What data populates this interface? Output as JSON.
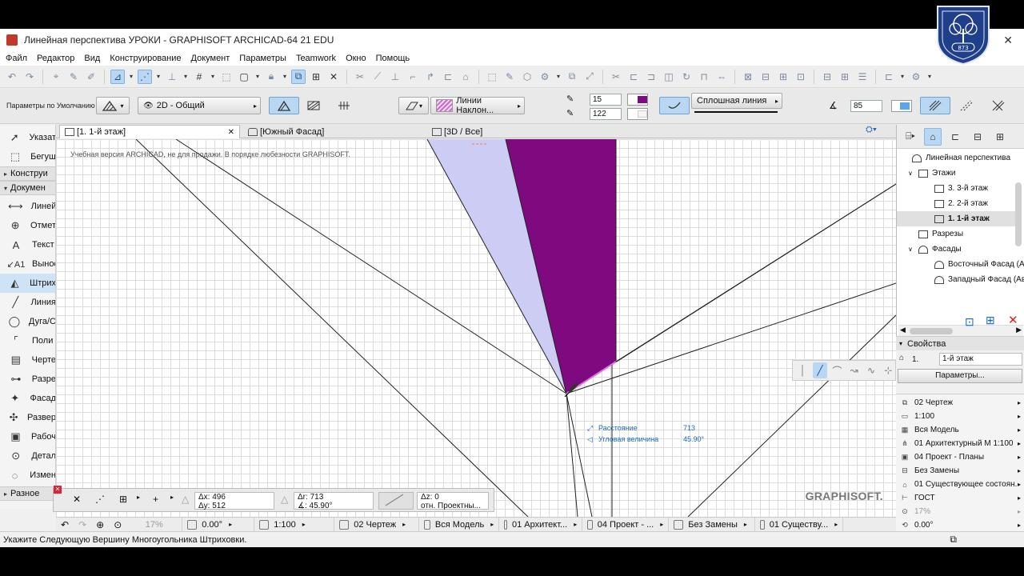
{
  "window": {
    "title": "Линейная перспектива УРОКИ - GRAPHISOFT ARCHICAD-64 21 EDU",
    "close_glyph": "✕"
  },
  "menu": [
    "Файл",
    "Редактор",
    "Вид",
    "Конструирование",
    "Документ",
    "Параметры",
    "Teamwork",
    "Окно",
    "Помощь"
  ],
  "infobox": {
    "default_params_label": "Параметры по Умолчанию",
    "layer": "2D - Общий",
    "fill_type": "Линии Наклон...",
    "pen_value_1": "15",
    "pen_value_2": "122",
    "line_type": "Сплошная линия",
    "angle_value": "85"
  },
  "toolbox": {
    "items": [
      {
        "label": "Указат",
        "icon": "arrow-icon"
      },
      {
        "label": "Бегущ",
        "icon": "marquee-icon"
      },
      {
        "label": "Линей",
        "icon": "linear-dimension-icon"
      },
      {
        "label": "Отмет",
        "icon": "level-dimension-icon"
      },
      {
        "label": "Текст",
        "icon": "text-icon"
      },
      {
        "label": "Вынос",
        "icon": "label-icon"
      },
      {
        "label": "Штрих",
        "icon": "fill-icon"
      },
      {
        "label": "Линия",
        "icon": "line-icon"
      },
      {
        "label": "Дуга/С",
        "icon": "arc-icon"
      },
      {
        "label": "Поли",
        "icon": "polyline-icon"
      },
      {
        "label": "Черте",
        "icon": "drawing-icon"
      },
      {
        "label": "Разре",
        "icon": "section-icon"
      },
      {
        "label": "Фасад",
        "icon": "elevation-icon"
      },
      {
        "label": "Развер",
        "icon": "interior-elevation-icon"
      },
      {
        "label": "Рабоч",
        "icon": "worksheet-icon"
      },
      {
        "label": "Детал",
        "icon": "detail-icon"
      },
      {
        "label": "Измен",
        "icon": "change-icon"
      }
    ],
    "groups": {
      "construct": "Конструи",
      "document": "Докумен",
      "misc": "Разное"
    }
  },
  "tabs": [
    {
      "label": "[1. 1-й этаж]",
      "active": true,
      "close": "✕"
    },
    {
      "label": "[Южный Фасад]",
      "active": false
    },
    {
      "label": "[3D / Все]",
      "active": false
    }
  ],
  "canvas": {
    "notice": "Учебная версия ARCHICAD, не для продажи. В порядке любезности GRAPHISOFT.",
    "brand": "GRAPHISOFT.",
    "tracker": {
      "distance_label": "Расстояние",
      "distance_value": "713",
      "angle_label": "Угловая величина",
      "angle_value": "45.90°"
    },
    "colors": {
      "fill_light": "#ccccf4",
      "fill_dark": "#7f0a7f",
      "lines": "#222222"
    }
  },
  "coords": {
    "dx": "Δx: 496",
    "dy": "Δy: 512",
    "dr": "Δr: 713",
    "da": "∡: 45.90°",
    "dz": "Δz: 0",
    "ref": "отн. Проектны..."
  },
  "quick_options": {
    "zoom": "17%",
    "rotation": "0.00°",
    "scale": "1:100",
    "layer_combo": "02 Чертеж",
    "model_view": "Вся Модель",
    "pen_set": "01 Архитект...",
    "display": "04 Проект - ...",
    "override": "Без Замены",
    "renovation": "01 Существу..."
  },
  "status": {
    "text": "Укажите Следующую Вершину Многоугольника Штриховки."
  },
  "navigator": {
    "items": [
      {
        "label": "Линейная перспектива",
        "level": 0,
        "twisty": ""
      },
      {
        "label": "Этажи",
        "level": 1,
        "twisty": "∨"
      },
      {
        "label": "3. 3-й этаж",
        "level": 2,
        "twisty": ""
      },
      {
        "label": "2. 2-й этаж",
        "level": 2,
        "twisty": ""
      },
      {
        "label": "1. 1-й этаж",
        "level": 2,
        "twisty": "",
        "selected": true
      },
      {
        "label": "Разрезы",
        "level": 1,
        "twisty": ""
      },
      {
        "label": "Фасады",
        "level": 1,
        "twisty": "∨"
      },
      {
        "label": "Восточный Фасад (Ав",
        "level": 2,
        "twisty": ""
      },
      {
        "label": "Западный Фасад (Ав",
        "level": 2,
        "twisty": ""
      }
    ]
  },
  "properties": {
    "header": "Свойства",
    "id": "1.",
    "name": "1-й этаж",
    "button": "Параметры..."
  },
  "lower_panel": [
    {
      "label": "02 Чертеж",
      "icon": "layers-icon"
    },
    {
      "label": "1:100",
      "icon": "scale-icon"
    },
    {
      "label": "Вся Модель",
      "icon": "model-view-icon"
    },
    {
      "label": "01 Архитектурный М 1:100",
      "icon": "pen-set-icon"
    },
    {
      "label": "04 Проект - Планы",
      "icon": "display-icon"
    },
    {
      "label": "Без Замены",
      "icon": "override-icon"
    },
    {
      "label": "01 Существующее состоян.",
      "icon": "renovation-icon"
    },
    {
      "label": "ГОСТ",
      "icon": "dimension-icon"
    },
    {
      "label": "17%",
      "icon": "zoom-icon",
      "dim": true
    },
    {
      "label": "0.00°",
      "icon": "rotate-icon"
    }
  ]
}
